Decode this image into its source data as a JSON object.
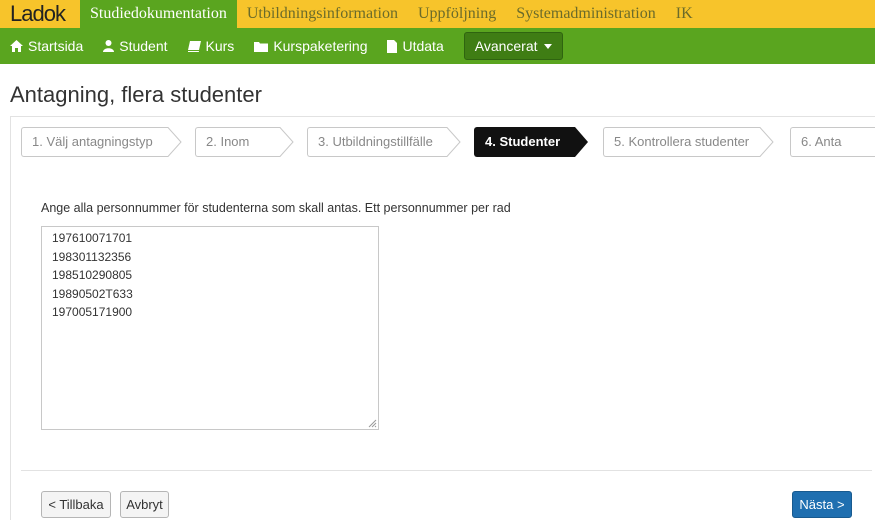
{
  "logo": {
    "text": "Ladok"
  },
  "topnav": {
    "items": [
      {
        "label": "Studiedokumentation",
        "active": true
      },
      {
        "label": "Utbildningsinformation",
        "active": false
      },
      {
        "label": "Uppföljning",
        "active": false
      },
      {
        "label": "Systemadministration",
        "active": false
      },
      {
        "label": "IK",
        "active": false
      }
    ]
  },
  "greennav": {
    "startsida": "Startsida",
    "student": "Student",
    "kurs": "Kurs",
    "kurspaketering": "Kurspaketering",
    "utdata": "Utdata",
    "avancerat": "Avancerat"
  },
  "page": {
    "title": "Antagning, flera studenter"
  },
  "steps": [
    {
      "label": "1. Välj antagningstyp",
      "active": false
    },
    {
      "label": "2. Inom",
      "active": false
    },
    {
      "label": "3. Utbildningstillfälle",
      "active": false
    },
    {
      "label": "4. Studenter",
      "active": true
    },
    {
      "label": "5. Kontrollera studenter",
      "active": false
    },
    {
      "label": "6. Anta",
      "active": false
    }
  ],
  "form": {
    "instruction": "Ange alla personnummer för studenterna som skall antas. Ett personnummer per rad",
    "personnummer": "197610071701\n198301132356\n198510290805\n19890502T633\n197005171900"
  },
  "buttons": {
    "back": "< Tillbaka",
    "cancel": "Avbryt",
    "next": "Nästa >"
  },
  "colors": {
    "topbar": "#f7c42b",
    "green": "#5aa51f",
    "active_step": "#111111",
    "primary": "#1f6fb0"
  }
}
